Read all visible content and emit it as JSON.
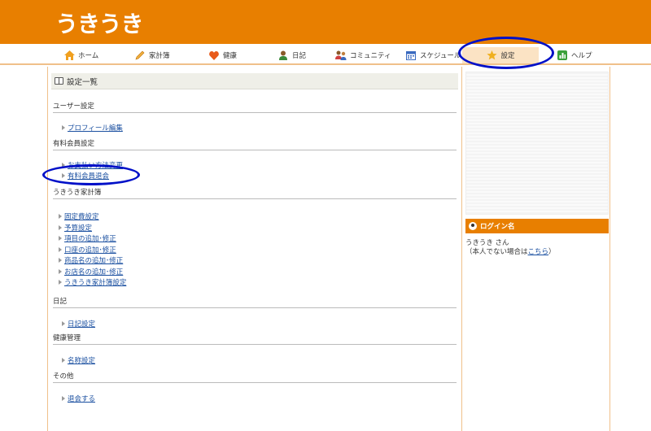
{
  "header": {
    "logo": "うきうき"
  },
  "nav": {
    "items": [
      {
        "label": "ホーム",
        "icon": "home-icon"
      },
      {
        "label": "家計簿",
        "icon": "pencil-icon"
      },
      {
        "label": "健康",
        "icon": "heart-icon"
      },
      {
        "label": "日記",
        "icon": "person-icon"
      },
      {
        "label": "コミュニティ",
        "icon": "community-icon"
      },
      {
        "label": "スケジュール",
        "icon": "calendar-icon"
      },
      {
        "label": "設定",
        "icon": "star-icon"
      },
      {
        "label": "ヘルプ",
        "icon": "help-icon"
      }
    ],
    "active": "設定"
  },
  "main": {
    "panel_title": "設定一覧",
    "sections": [
      {
        "title": "ユーザー設定",
        "links": [
          "プロフィール編集"
        ]
      },
      {
        "title": "有料会員設定",
        "links": [
          "お支払い方法変更",
          "有料会員退会"
        ]
      },
      {
        "title": "うきうき家計簿",
        "links": [
          "固定費設定",
          "予算設定",
          "項目の追加･修正",
          "口座の追加･修正",
          "商品名の追加･修正",
          "お店名の追加･修正",
          "うきうき家計簿設定"
        ]
      },
      {
        "title": "日記",
        "links": [
          "日記設定"
        ]
      },
      {
        "title": "健康管理",
        "links": [
          "名称設定"
        ]
      },
      {
        "title": "その他",
        "links": [
          "退会する"
        ]
      }
    ]
  },
  "sidebar": {
    "login_title": "ログイン名",
    "user_name": "うきうき さん",
    "not_you_prefix": "（本人でない場合は",
    "not_you_link": "こちら",
    "not_you_suffix": "）"
  },
  "colors": {
    "brand": "#e87f00",
    "link": "#1a4fa0",
    "annotation": "#0010c8"
  }
}
